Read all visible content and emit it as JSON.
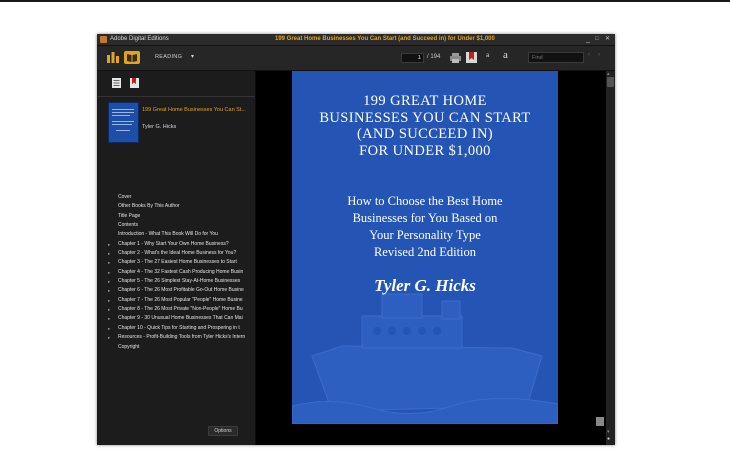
{
  "window": {
    "app_name": "Adobe Digital Editions",
    "document_title": "199 Great Home Businesses You Can Start (and Succeed in) for Under $1,000",
    "controls": {
      "minimize": "_",
      "maximize": "□",
      "close": "✕"
    }
  },
  "toolbar": {
    "reading_mode": "READING",
    "current_page": "1",
    "total_pages": "/ 194",
    "font_size_glyph": "a",
    "font_size_small_glyph": "a",
    "find_placeholder": "Find",
    "find_prev": "‹",
    "find_next": "›"
  },
  "sidebar": {
    "book_title": "199 Great Home Businesses You Can St...",
    "book_author": "Tyler G. Hicks",
    "toc": [
      {
        "label": "Cover",
        "expandable": false
      },
      {
        "label": "Other Books By This Author",
        "expandable": false
      },
      {
        "label": "Title Page",
        "expandable": false
      },
      {
        "label": "Contents",
        "expandable": false
      },
      {
        "label": "Introduction - What This Book Will Do for You",
        "expandable": false
      },
      {
        "label": "Chapter 1 - Why Start Your Own Home Business?",
        "expandable": true
      },
      {
        "label": "Chapter 2 - What's the Ideal Home Business for You?",
        "expandable": true
      },
      {
        "label": "Chapter 3 - The 27 Easiest Home Businesses to Start",
        "expandable": true
      },
      {
        "label": "Chapter 4 - The 32 Fastest Cash Producing Home Busin",
        "expandable": true
      },
      {
        "label": "Chapter 5 - The 26 Simplest Stay-At-Home Businesses",
        "expandable": true
      },
      {
        "label": "Chapter 6 - The 26 Most Profitable Go-Out Home Busine",
        "expandable": true
      },
      {
        "label": "Chapter 7 - The 26 Most Popular \"People\" Home Busine",
        "expandable": true
      },
      {
        "label": "Chapter 8 - The 26 Most Private \"Non-People\" Home Bu",
        "expandable": true
      },
      {
        "label": "Chapter 9 - 30 Unusual Home Businesses That Can Mai",
        "expandable": true
      },
      {
        "label": "Chapter 10 - Quick Tips for Starting and Prospering in t",
        "expandable": true
      },
      {
        "label": "Resources - Profit-Building Tools from Tyler Hicks's Intern",
        "expandable": true
      },
      {
        "label": "Copyright",
        "expandable": false
      }
    ],
    "options_label": "Options"
  },
  "page": {
    "title_lines": [
      "199 GREAT HOME",
      "BUSINESSES YOU CAN START",
      "(AND SUCCEED IN)",
      "FOR UNDER $1,000"
    ],
    "subtitle_lines": [
      "How to Choose the Best Home",
      "Businesses for You Based on",
      "Your Personality Type",
      "Revised 2nd Edition"
    ],
    "author": "Tyler G. Hicks"
  },
  "colors": {
    "accent": "#e0a51f",
    "cover_blue": "#2455b5",
    "chrome_dark": "#1b1b1b"
  }
}
